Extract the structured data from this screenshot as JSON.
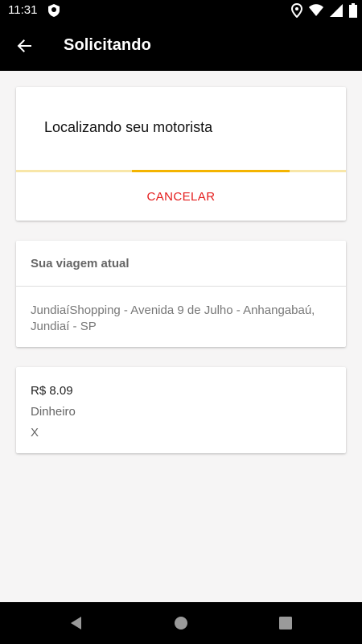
{
  "status_bar": {
    "time": "11:31",
    "icons": [
      "location-shield-icon",
      "location-pin-icon",
      "wifi-icon",
      "signal-icon",
      "battery-icon"
    ]
  },
  "app_bar": {
    "title": "Solicitando",
    "back_icon": "arrow-left-icon"
  },
  "search_card": {
    "message": "Localizando seu motorista",
    "cancel_label": "CANCELAR",
    "progress": {
      "start": 0.35,
      "end": 0.83
    },
    "colors": {
      "bar": "#f4b400",
      "track": "#f8e6a8",
      "cancel": "#e41b1b"
    }
  },
  "trip_card": {
    "header": "Sua viagem atual",
    "address": "JundiaíShopping - Avenida 9 de Julho - Anhangabaú, Jundiaí - SP"
  },
  "payment_card": {
    "price": "R$ 8.09",
    "method": "Dinheiro",
    "extra": "X"
  },
  "nav_bar": {
    "buttons": [
      "back-triangle-icon",
      "home-circle-icon",
      "recents-square-icon"
    ]
  }
}
